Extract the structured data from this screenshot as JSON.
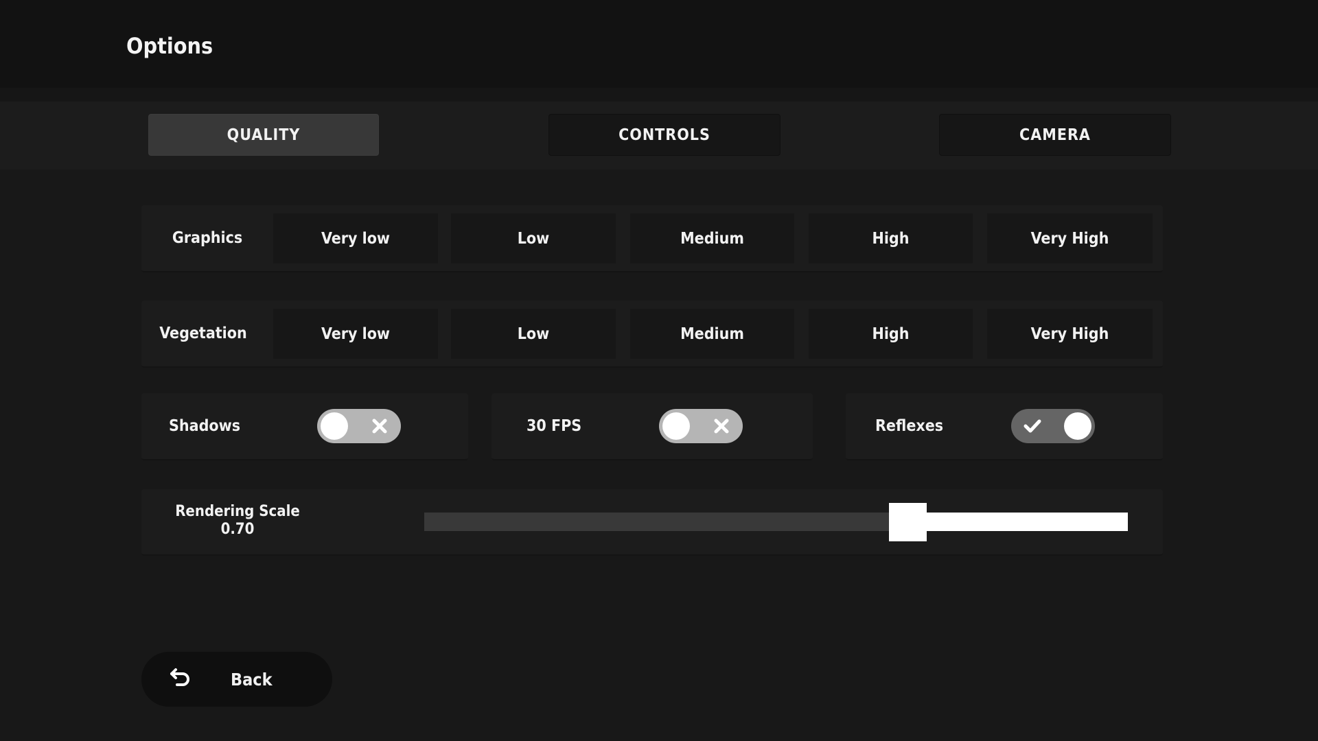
{
  "header": {
    "title": "Options"
  },
  "tabs": [
    {
      "label": "QUALITY",
      "active": true
    },
    {
      "label": "CONTROLS",
      "active": false
    },
    {
      "label": "CAMERA",
      "active": false
    }
  ],
  "quality": {
    "graphics": {
      "label": "Graphics",
      "options": [
        "Very low",
        "Low",
        "Medium",
        "High",
        "Very High"
      ],
      "selected": null
    },
    "vegetation": {
      "label": "Vegetation",
      "options": [
        "Very low",
        "Low",
        "Medium",
        "High",
        "Very High"
      ],
      "selected": null
    },
    "toggles": [
      {
        "label": "Shadows",
        "on": false,
        "icon": "x-icon"
      },
      {
        "label": "30 FPS",
        "on": false,
        "icon": "x-icon"
      },
      {
        "label": "Reflexes",
        "on": true,
        "icon": "check-icon"
      }
    ],
    "rendering_scale": {
      "label": "Rendering Scale",
      "value_text": "0.70",
      "fill_fraction": 0.66
    }
  },
  "back": {
    "label": "Back",
    "icon": "undo-arrow-icon"
  },
  "colors": {
    "background": "#181818",
    "header": "#121212",
    "tabbar": "#1c1c1c",
    "active_tab": "#383838",
    "panel": "#1c1c1c",
    "option_cell": "#171717",
    "toggle_off": "#b5b5b5",
    "toggle_on": "#656565",
    "slider_track": "#393939",
    "slider_fill": "#ffffff"
  }
}
